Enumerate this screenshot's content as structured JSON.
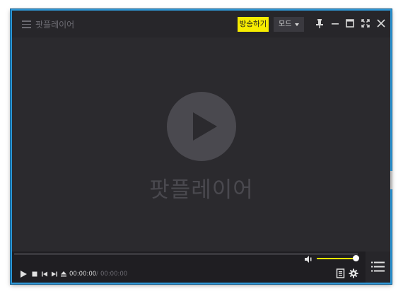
{
  "window": {
    "title": "팟플레이어",
    "accent": "#2e97d6"
  },
  "titlebar": {
    "menu_icon": "hamburger-icon",
    "broadcast_label": "방송하기",
    "broadcast_color": "#f6ec00",
    "mode_label": "모드",
    "buttons": [
      "pin-icon",
      "minimize-icon",
      "maximize-icon",
      "fullscreen-icon",
      "close-icon"
    ]
  },
  "video": {
    "logo_text": "팟플레이어",
    "play_icon": "play-circle-icon"
  },
  "controls": {
    "current_time": "00:00:00",
    "separator": "/",
    "total_time": "00:00:00",
    "seek_progress": 0,
    "volume_level": 1.0,
    "volume_color": "#f6ec00",
    "icons": [
      "play-icon",
      "stop-icon",
      "prev-icon",
      "next-icon",
      "eject-icon",
      "volume-icon",
      "playlist-view-icon",
      "settings-icon",
      "playlist-icon"
    ]
  }
}
